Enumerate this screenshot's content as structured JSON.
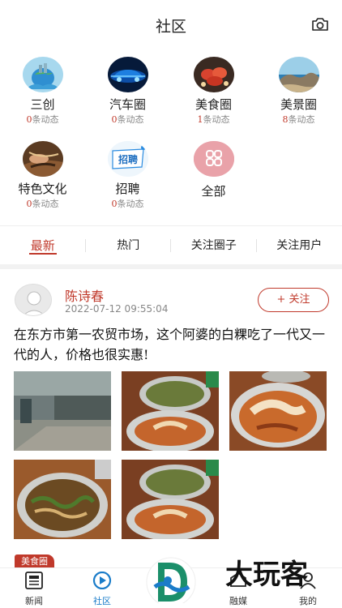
{
  "header": {
    "title": "社区",
    "camera_icon": "camera-icon"
  },
  "circles": [
    {
      "name": "三创",
      "count": "0",
      "suffix": "条动态",
      "icon": "earth-hands-image"
    },
    {
      "name": "汽车圈",
      "count": "0",
      "suffix": "条动态",
      "icon": "car-image"
    },
    {
      "name": "美食圈",
      "count": "1",
      "suffix": "条动态",
      "icon": "seafood-image"
    },
    {
      "name": "美景圈",
      "count": "8",
      "suffix": "条动态",
      "icon": "coast-image"
    },
    {
      "name": "特色文化",
      "count": "0",
      "suffix": "条动态",
      "icon": "craft-image"
    },
    {
      "name": "招聘",
      "count": "0",
      "suffix": "条动态",
      "icon": "recruit-image",
      "icon_text": "招聘"
    },
    {
      "name": "全部",
      "icon": "all-grid-icon"
    }
  ],
  "tabs": [
    {
      "label": "最新",
      "active": true
    },
    {
      "label": "热门",
      "active": false
    },
    {
      "label": "关注圈子",
      "active": false
    },
    {
      "label": "关注用户",
      "active": false
    }
  ],
  "post": {
    "author": "陈诗春",
    "time": "2022-07-12 09:55:04",
    "follow_label": "+ 关注",
    "text": "在东方市第一农贸市场，这个阿婆的白粿吃了一代又一代的人，价格也很实惠!",
    "tag": "美食圈",
    "photos": [
      "market-photo",
      "food-photo",
      "food-closeup-photo",
      "noodles-photo",
      "food-photo-2"
    ]
  },
  "bottom_nav": [
    {
      "label": "新闻",
      "icon": "news-icon",
      "active": false
    },
    {
      "label": "社区",
      "icon": "community-icon",
      "active": true
    },
    {
      "label": "",
      "icon": "app-logo",
      "active": false
    },
    {
      "label": "融媒",
      "icon": "media-icon",
      "active": false
    },
    {
      "label": "我的",
      "icon": "profile-icon",
      "active": false
    }
  ],
  "watermark": {
    "text": "大玩客"
  },
  "colors": {
    "accent": "#c0392b",
    "nav_active": "#1a7cc9",
    "muted": "#888888"
  }
}
